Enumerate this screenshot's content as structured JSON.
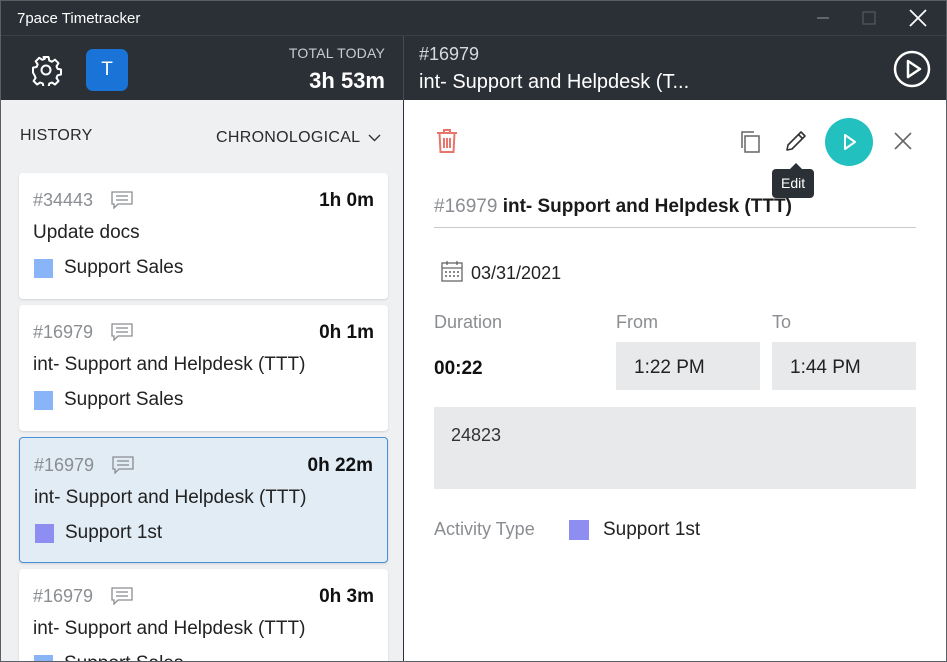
{
  "window": {
    "title": "7pace Timetracker"
  },
  "header": {
    "avatar_letter": "T",
    "total_label": "TOTAL TODAY",
    "total_value": "3h 53m",
    "current_id": "#16979",
    "current_title": "int- Support and Helpdesk (T..."
  },
  "history": {
    "label": "HISTORY",
    "sort_label": "CHRONOLOGICAL",
    "items": [
      {
        "id": "#34443",
        "duration": "1h 0m",
        "title": "Update docs",
        "activity": "Support Sales",
        "color": "#89b4f7",
        "selected": false
      },
      {
        "id": "#16979",
        "duration": "0h 1m",
        "title": "int- Support and Helpdesk (TTT)",
        "activity": "Support Sales",
        "color": "#89b4f7",
        "selected": false
      },
      {
        "id": "#16979",
        "duration": "0h 22m",
        "title": "int- Support and Helpdesk (TTT)",
        "activity": "Support 1st",
        "color": "#8e8ef2",
        "selected": true
      },
      {
        "id": "#16979",
        "duration": "0h 3m",
        "title": "int- Support and Helpdesk (TTT)",
        "activity": "Support Sales",
        "color": "#89b4f7",
        "selected": false
      }
    ]
  },
  "detail": {
    "tooltip": "Edit",
    "id": "#16979",
    "title": "int- Support and Helpdesk (TTT)",
    "date": "03/31/2021",
    "duration_label": "Duration",
    "from_label": "From",
    "to_label": "To",
    "duration": "00:22",
    "from": "1:22 PM",
    "to": "1:44 PM",
    "notes": "24823",
    "activity_label": "Activity Type",
    "activity": "Support 1st",
    "activity_color": "#8e8ef2"
  },
  "colors": {
    "accent_play": "#23c0c0",
    "avatar": "#1a73d6",
    "trash": "#e8756b",
    "selected_border": "#4a90d9"
  },
  "icons": [
    "gear-icon",
    "play-circle-icon",
    "trash-icon",
    "copy-icon",
    "pencil-icon",
    "play-icon",
    "close-icon",
    "calendar-icon",
    "comment-icon",
    "chevron-down-icon"
  ]
}
